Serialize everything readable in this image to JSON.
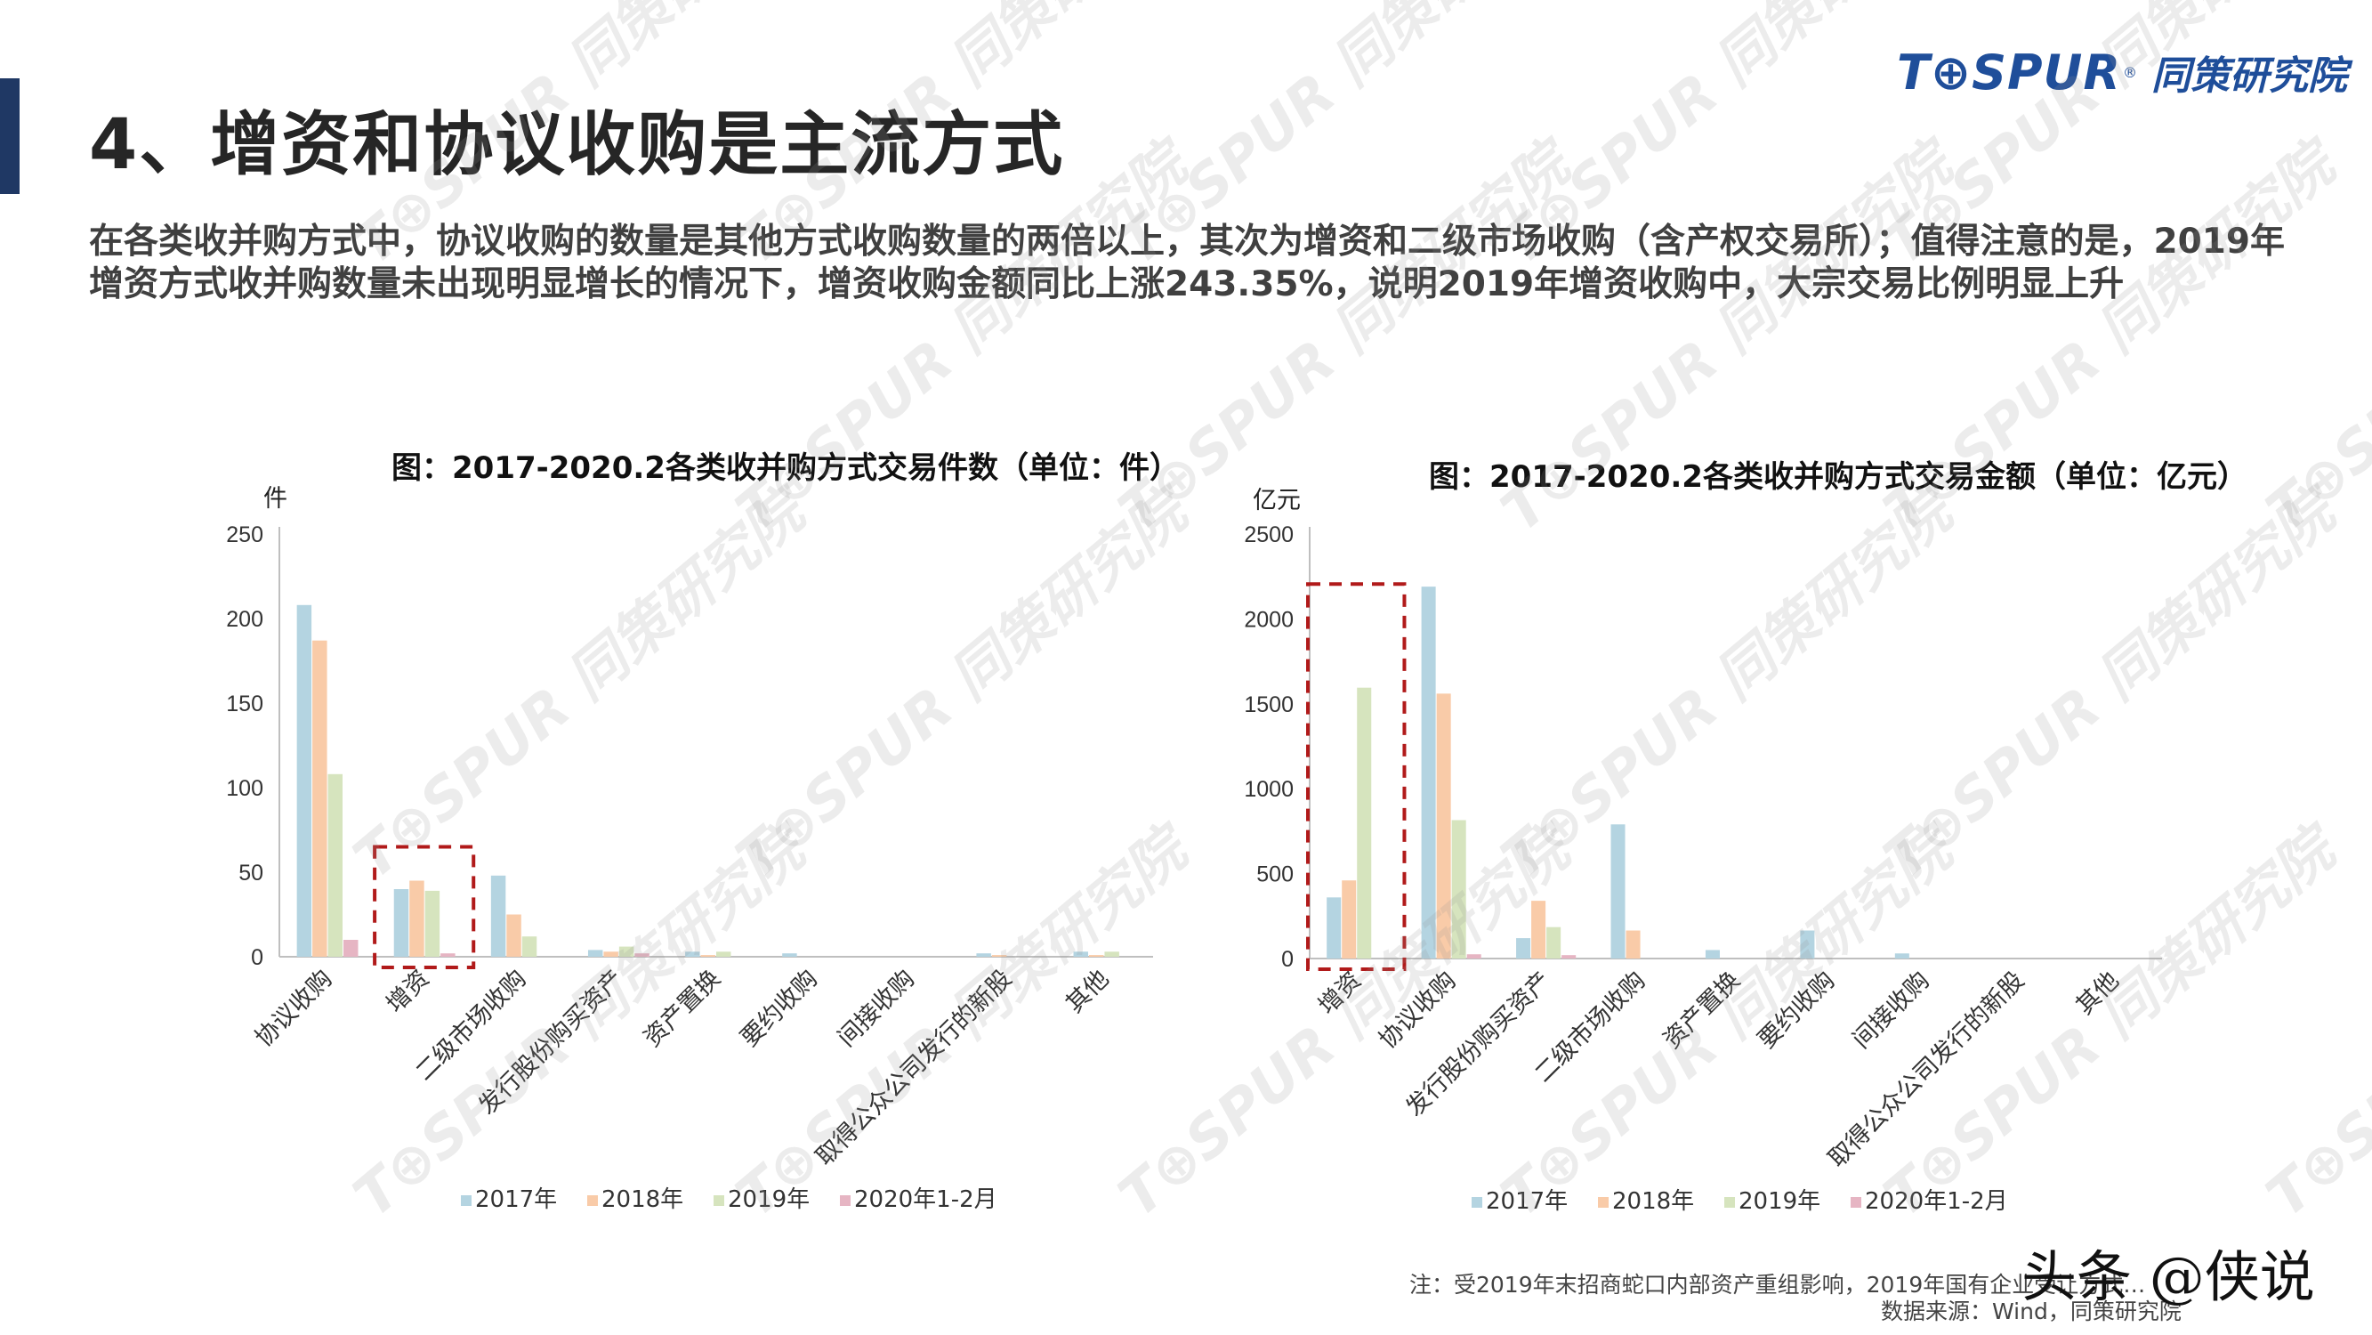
{
  "page": {
    "title": "4、增资和协议收购是主流方式",
    "intro": "在各类收并购方式中，协议收购的数量是其他方式收购数量的两倍以上，其次为增资和二级市场收购（含产权交易所）；值得注意的是，2019年增资方式收并购数量未出现明显增长的情况下，增资收购金额同比上涨243.35%，说明2019年增资收购中，大宗交易比例明显上升",
    "logo_text": "T⊕SPUR",
    "logo_reg": "®",
    "logo_cn": "同策研究院",
    "note": "注：受2019年末招商蛇口内部资产重组影响，2019年国有企业受让方式…",
    "source": "数据来源：Wind，同策研究院",
    "brand_text": "头条 @侠说",
    "watermark_text": "T⊕SPUR 同策研究院"
  },
  "colors": {
    "accent_bar": "#1f3864",
    "series": [
      "#b4d4e1",
      "#f9cba8",
      "#d6e4be",
      "#e6b5c3"
    ],
    "highlight_box": "#b11a1a",
    "logo": "#1f4e9a"
  },
  "chart_data": [
    {
      "type": "bar",
      "title": "图：2017-2020.2各类收并购方式交易件数（单位：件）",
      "ylabel": "件",
      "ylim": [
        0,
        250
      ],
      "yticks": [
        0,
        50,
        100,
        150,
        200,
        250
      ],
      "categories": [
        "协议收购",
        "增资",
        "二级市场收购",
        "发行股份购买资产",
        "资产置换",
        "要约收购",
        "间接收购",
        "取得公众公司发行的新股",
        "其他"
      ],
      "series": [
        {
          "name": "2017年",
          "values": [
            208,
            40,
            48,
            4,
            3,
            2,
            0,
            2,
            3
          ]
        },
        {
          "name": "2018年",
          "values": [
            187,
            45,
            25,
            3,
            1,
            0,
            0,
            1,
            1
          ]
        },
        {
          "name": "2019年",
          "values": [
            108,
            39,
            12,
            6,
            3,
            0,
            0,
            0,
            3
          ]
        },
        {
          "name": "2020年1-2月",
          "values": [
            10,
            2,
            0,
            2,
            0,
            0,
            0,
            0,
            0
          ]
        }
      ],
      "highlight_category": "增资",
      "legend_position": "bottom",
      "grid": false
    },
    {
      "type": "bar",
      "title": "图：2017-2020.2各类收并购方式交易金额（单位：亿元）",
      "ylabel": "亿元",
      "ylim": [
        0,
        2500
      ],
      "yticks": [
        0,
        500,
        1000,
        1500,
        2000,
        2500
      ],
      "categories": [
        "增资",
        "协议收购",
        "发行股份购买资产",
        "二级市场收购",
        "资产置换",
        "要约收购",
        "间接收购",
        "取得公众公司发行的新股",
        "其他"
      ],
      "series": [
        {
          "name": "2017年",
          "values": [
            360,
            2190,
            120,
            790,
            50,
            165,
            30,
            0,
            0
          ]
        },
        {
          "name": "2018年",
          "values": [
            460,
            1560,
            340,
            165,
            0,
            0,
            0,
            0,
            0
          ]
        },
        {
          "name": "2019年",
          "values": [
            1595,
            815,
            185,
            0,
            0,
            0,
            0,
            0,
            0
          ]
        },
        {
          "name": "2020年1-2月",
          "values": [
            0,
            25,
            20,
            0,
            0,
            0,
            0,
            0,
            0
          ]
        }
      ],
      "highlight_category": "增资",
      "legend_position": "bottom",
      "grid": false
    }
  ]
}
